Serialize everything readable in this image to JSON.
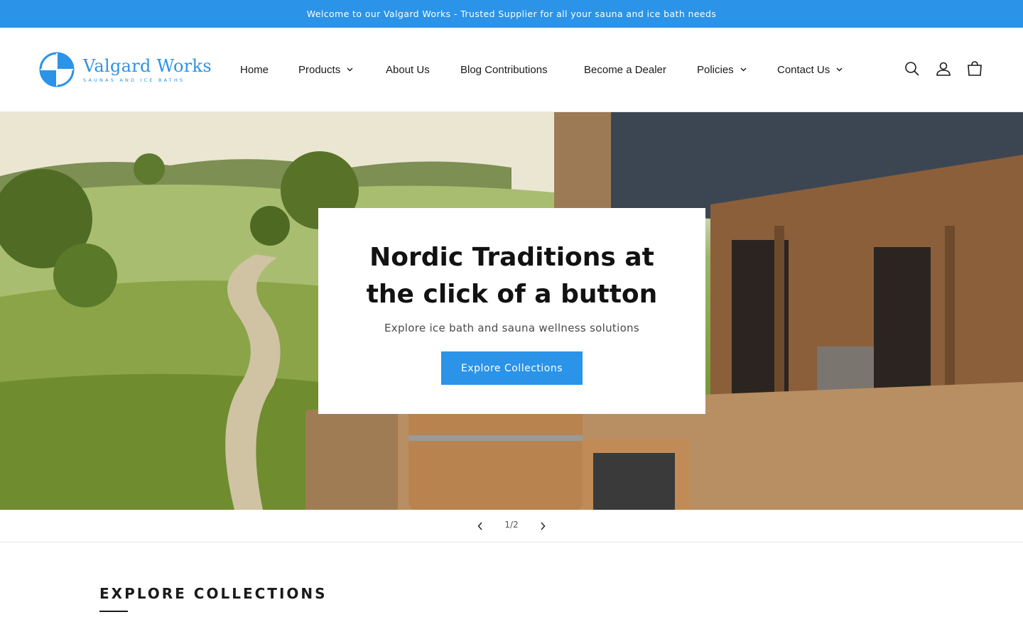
{
  "announcement": {
    "text": "Welcome to our Valgard Works - Trusted Supplier for all your sauna and ice bath needs"
  },
  "brand": {
    "name": "Valgard Works",
    "tagline": "SAUNAS AND ICE BATHS",
    "color": "#2b93e8"
  },
  "nav": {
    "items": [
      {
        "label": "Home",
        "dropdown": false
      },
      {
        "label": "Products",
        "dropdown": true
      },
      {
        "label": "About Us",
        "dropdown": false
      },
      {
        "label": "Blog Contributions",
        "dropdown": false
      },
      {
        "label": "Become a Dealer",
        "dropdown": false
      },
      {
        "label": "Policies",
        "dropdown": true
      },
      {
        "label": "Contact Us",
        "dropdown": true
      }
    ]
  },
  "header_icons": [
    "search-icon",
    "account-icon",
    "cart-icon"
  ],
  "hero": {
    "title": "Nordic Traditions at the click of a button",
    "subtitle": "Explore ice bath and sauna wellness solutions",
    "button_label": "Explore Collections"
  },
  "slider": {
    "counter": "1/2"
  },
  "collections": {
    "heading": "EXPLORE COLLECTIONS"
  }
}
